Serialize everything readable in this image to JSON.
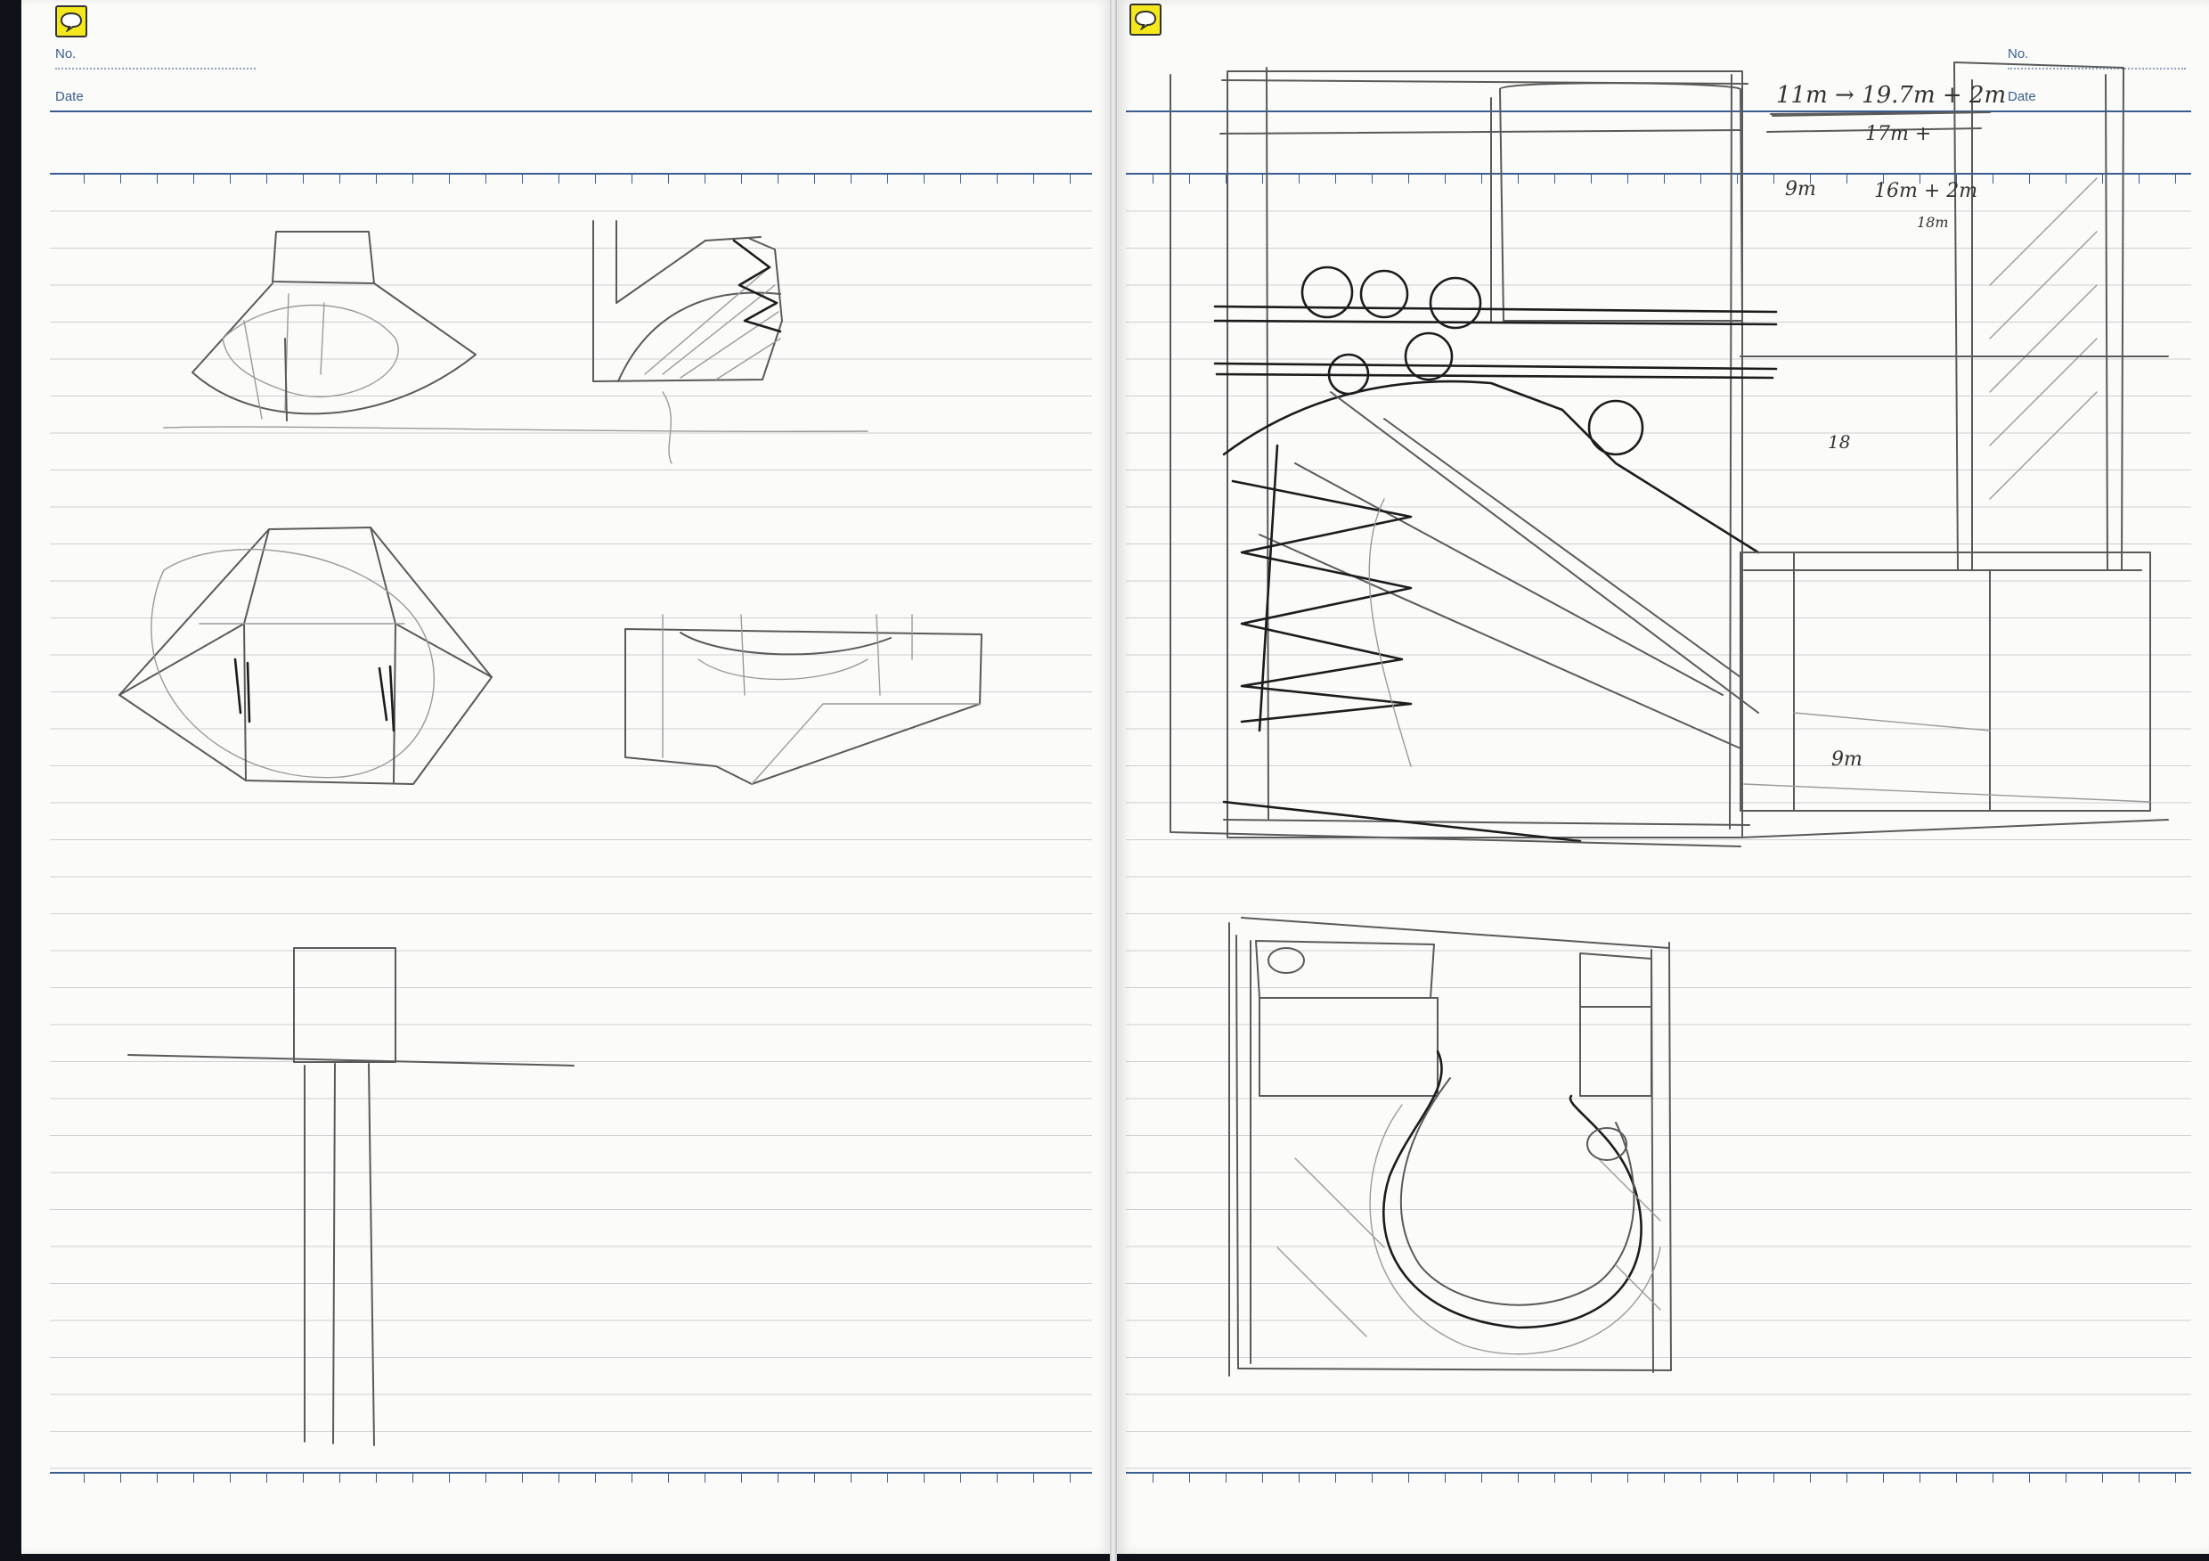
{
  "notebook": {
    "left_page": {
      "no_label": "No.",
      "date_label": "Date"
    },
    "right_page": {
      "no_label": "No.",
      "date_label": "Date"
    },
    "icons": {
      "left": "speech-bubble-icon",
      "right": "speech-bubble-icon"
    },
    "colors": {
      "rule_blue": "#3a5e92",
      "tag_yellow": "#f4e81c",
      "paper": "#fbfbf9"
    }
  },
  "annotations": {
    "width_line1": "11m → 19.7m + 2m",
    "width_line2": "17m +",
    "depth_line1": "9m",
    "depth_line2": "16m + 2m",
    "depth_line3": "18m",
    "mid_mark": "18",
    "room_height": "9m"
  }
}
